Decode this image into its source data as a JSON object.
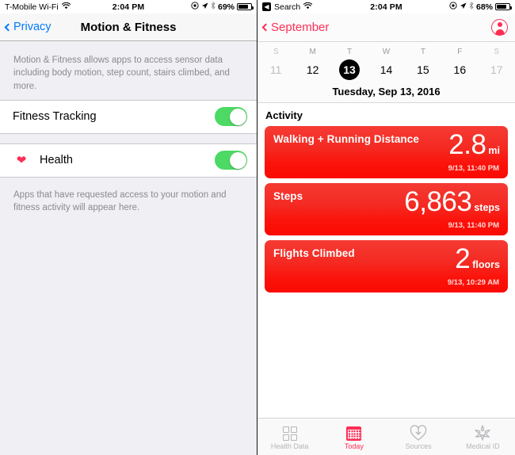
{
  "left_screen": {
    "statusbar": {
      "carrier": "T-Mobile Wi-Fi",
      "wifi_icon": "wifi-icon",
      "time": "2:04 PM",
      "alarm_icon": "alarm-icon",
      "location_icon": "location-arrow-icon",
      "bluetooth_icon": "bluetooth-icon",
      "battery_percent": "69%",
      "battery_icon": "battery-icon"
    },
    "navbar": {
      "back_label": "Privacy",
      "back_icon": "chevron-left-icon",
      "title": "Motion & Fitness"
    },
    "description": "Motion & Fitness allows apps to access sensor data including body motion, step count, stairs climbed, and more.",
    "fitness_tracking": {
      "label": "Fitness Tracking",
      "toggle_state": "on",
      "toggle_color": "#4CD964"
    },
    "apps": [
      {
        "label": "Health",
        "icon": "heart-icon",
        "icon_color": "#FF2D55",
        "toggle_state": "on"
      }
    ],
    "apps_footer": "Apps that have requested access to your motion and fitness activity will appear here."
  },
  "right_screen": {
    "statusbar": {
      "back_badge": "back-arrow-badge-icon",
      "back_app": "Search",
      "wifi_icon": "wifi-icon",
      "time": "2:04 PM",
      "alarm_icon": "alarm-icon",
      "location_icon": "location-arrow-icon",
      "bluetooth_icon": "bluetooth-icon",
      "battery_percent": "68%",
      "battery_icon": "battery-icon"
    },
    "navbar": {
      "back_label": "September",
      "back_icon": "chevron-left-icon",
      "profile_icon": "profile-circle-icon",
      "accent_color": "#FF2D55"
    },
    "calendar": {
      "dow": [
        "S",
        "M",
        "T",
        "W",
        "T",
        "F",
        "S"
      ],
      "dates": [
        "11",
        "12",
        "13",
        "14",
        "15",
        "16",
        "17"
      ],
      "selected_index": 2,
      "dim_indices": [
        0,
        6
      ],
      "full_date": "Tuesday, Sep 13, 2016"
    },
    "activity": {
      "section_title": "Activity",
      "cards": [
        {
          "name": "Walking + Running Distance",
          "value": "2.8",
          "unit": "mi",
          "timestamp": "9/13, 11:40 PM"
        },
        {
          "name": "Steps",
          "value": "6,863",
          "unit": "steps",
          "timestamp": "9/13, 11:40 PM"
        },
        {
          "name": "Flights Climbed",
          "value": "2",
          "unit": "floors",
          "timestamp": "9/13, 10:29 AM"
        }
      ]
    },
    "tabbar": {
      "items": [
        {
          "label": "Health Data",
          "icon": "grid-squares-icon",
          "active": false
        },
        {
          "label": "Today",
          "icon": "calendar-icon",
          "active": true
        },
        {
          "label": "Sources",
          "icon": "heart-download-icon",
          "active": false
        },
        {
          "label": "Medical ID",
          "icon": "star-of-life-icon",
          "active": false
        }
      ],
      "active_color": "#FF2D55",
      "inactive_color": "#B6B6BB"
    }
  }
}
